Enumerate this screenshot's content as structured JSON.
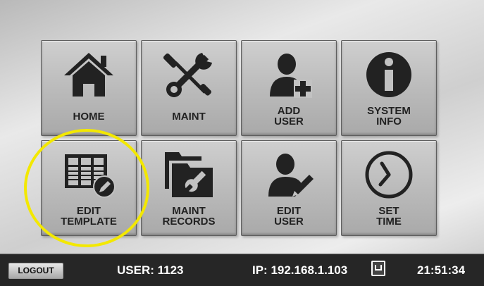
{
  "tiles": {
    "home": {
      "label": "HOME",
      "icon": "home-icon"
    },
    "maint": {
      "label": "MAINT",
      "icon": "wrench-screwdriver-icon"
    },
    "add_user": {
      "label": "ADD\nUSER",
      "icon": "add-user-icon"
    },
    "system_info": {
      "label": "SYSTEM\nINFO",
      "icon": "info-icon"
    },
    "edit_template": {
      "label": "EDIT\nTEMPLATE",
      "icon": "edit-template-icon"
    },
    "maint_records": {
      "label": "MAINT\nRECORDS",
      "icon": "folder-wrench-icon"
    },
    "edit_user": {
      "label": "EDIT\nUSER",
      "icon": "edit-user-icon"
    },
    "set_time": {
      "label": "SET\nTIME",
      "icon": "clock-icon"
    }
  },
  "statusbar": {
    "logout_label": "LOGOUT",
    "user": "USER: 1123",
    "ip": "IP: 192.168.1.103",
    "time": "21:51:34",
    "network_icon": "network-port-icon"
  },
  "colors": {
    "highlight": "#f3e800",
    "statusbar_bg": "#262626",
    "icon": "#222222"
  }
}
